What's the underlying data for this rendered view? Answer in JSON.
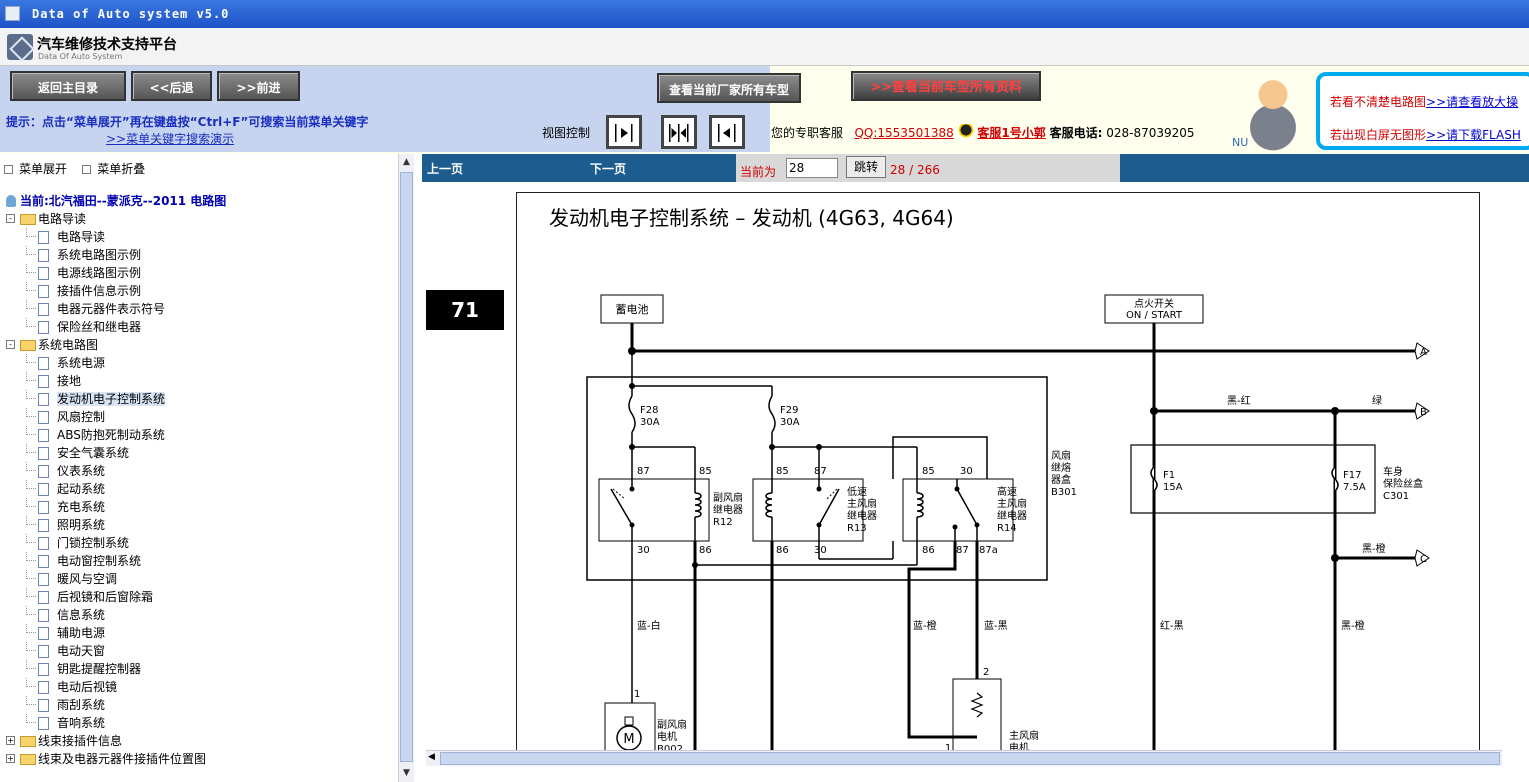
{
  "window": {
    "title": "Data of Auto system v5.0"
  },
  "brand": {
    "title": "汽车维修技术支持平台",
    "subtitle": "Data Of Auto System"
  },
  "toolbar": {
    "home_label": "返回主目录",
    "back_label": "<<后退",
    "forward_label": ">>前进",
    "maker_models_label": "查看当前厂家所有车型",
    "model_data_label": ">>查看当前车型所有资料",
    "hint_text": "提示：点击“菜单展开”再在键盘按“Ctrl+F”可搜索当前菜单关键字",
    "hint_link": ">>菜单关键字搜索演示",
    "view_control_label": "视图控制"
  },
  "service": {
    "prefix": "您的专职客服",
    "qq": "QQ:1553501388",
    "agent": "客服1号小郭",
    "phone_label": "客服电话:",
    "phone": "028-87039205"
  },
  "ad": {
    "line1_text": "若看不清楚电路图",
    "line1_link": ">>请查看放大操",
    "line2_text": "若出现白屏无图形",
    "line2_link": ">>请下载FLASH",
    "corner_text": "NU"
  },
  "menu": {
    "expand_label": "菜单展开",
    "collapse_label": "菜单折叠",
    "current": "当前:北汽福田--蒙派克--2011 电路图",
    "folder1": {
      "label": "电路导读",
      "sign": "-"
    },
    "folder1_items": [
      "电路导读",
      "系统电路图示例",
      "电源线路图示例",
      "接插件信息示例",
      "电器元器件表示符号",
      "保险丝和继电器"
    ],
    "folder2": {
      "label": "系统电路图",
      "sign": "-"
    },
    "folder2_items": [
      "系统电源",
      "接地",
      "发动机电子控制系统",
      "风扇控制",
      "ABS防抱死制动系统",
      "安全气囊系统",
      "仪表系统",
      "起动系统",
      "充电系统",
      "照明系统",
      "门锁控制系统",
      "电动窗控制系统",
      "暖风与空调",
      "后视镜和后窗除霜",
      "信息系统",
      "辅助电源",
      "电动天窗",
      "钥匙提醒控制器",
      "电动后视镜",
      "雨刮系统",
      "音响系统"
    ],
    "folder3": {
      "label": "线束接插件信息",
      "sign": "+"
    },
    "folder4": {
      "label": "线束及电器元器件接插件位置图",
      "sign": "+"
    },
    "selected_item": "发动机电子控制系统"
  },
  "pager": {
    "prev_label": "上一页",
    "next_label": "下一页",
    "current_label": "当前为",
    "current_value": "28",
    "go_label": "跳转",
    "count_text": "28 / 266",
    "page_badge": "71"
  },
  "diagram": {
    "title": "发动机电子控制系统 – 发动机 (4G63, 4G64)",
    "battery": "蓄电池",
    "ignition_l1": "点火开关",
    "ignition_l2": "ON / START",
    "conn_a": "A",
    "conn_b": "B",
    "conn_c": "C",
    "f28_name": "F28",
    "f28_rating": "30A",
    "f29_name": "F29",
    "f29_rating": "30A",
    "f1_name": "F1",
    "f1_rating": "15A",
    "f17_name": "F17",
    "f17_rating": "7.5A",
    "fan_box_l1": "风扇",
    "fan_box_l2": "继熔",
    "fan_box_l3": "器盒",
    "fan_box_l4": "B301",
    "body_box_l1": "车身",
    "body_box_l2": "保险丝盒",
    "body_box_l3": "C301",
    "r12_l1": "副风扇",
    "r12_l2": "继电器",
    "r12_l3": "R12",
    "r13_l1": "低速",
    "r13_l2": "主风扇",
    "r13_l3": "继电器",
    "r13_l4": "R13",
    "r14_l1": "高速",
    "r14_l2": "主风扇",
    "r14_l3": "继电器",
    "r14_l4": "R14",
    "pin87a": "87",
    "pin85a": "85",
    "pin30a": "30",
    "pin86a": "86",
    "pin85b": "85",
    "pin87b": "87",
    "pin86b": "86",
    "pin30b": "30",
    "pin85c": "85",
    "pin30c": "30",
    "pin86c": "86",
    "pin87c": "87",
    "pin87ac": "87a",
    "wire_black_red": "黑-红",
    "wire_green": "绿",
    "wire_black_orange_c": "黑-橙",
    "wire_blue_white": "蓝-白",
    "wire_blue_orange": "蓝-橙",
    "wire_blue_black": "蓝-黑",
    "wire_red_black": "红-黑",
    "wire_black_orange": "黑-橙",
    "motor_aux_l1": "副风扇",
    "motor_aux_l2": "电机",
    "motor_aux_l3": "B002",
    "motor_main_l1": "主风扇",
    "motor_main_l2": "电机",
    "motor_symbol": "M",
    "pin1_a": "1",
    "pin1_b": "1",
    "pin2_b": "2"
  },
  "colors": {
    "title_bar": "#1d53c8",
    "nav_bar": "#1d5c8f",
    "toolbar_blue": "#c6d4ef",
    "accent_red": "#d20000"
  }
}
